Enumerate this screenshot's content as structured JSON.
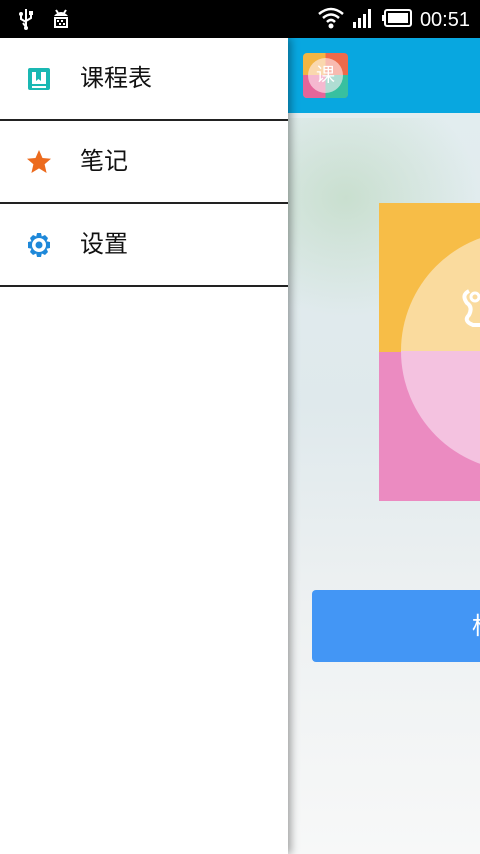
{
  "status_bar": {
    "time": "00:51",
    "icons": [
      "usb-icon",
      "debug-icon",
      "wifi-icon",
      "signal-icon",
      "battery-icon"
    ]
  },
  "drawer": {
    "items": [
      {
        "label": "课程表",
        "icon": "book-icon",
        "color": "#1ab8b3"
      },
      {
        "label": "笔记",
        "icon": "star-icon",
        "color": "#ec6b1e"
      },
      {
        "label": "设置",
        "icon": "gear-icon",
        "color": "#1e88d9"
      }
    ]
  },
  "main": {
    "appbar_color": "#08a7e0",
    "logo_text": "课",
    "button_text_partial": "标"
  }
}
